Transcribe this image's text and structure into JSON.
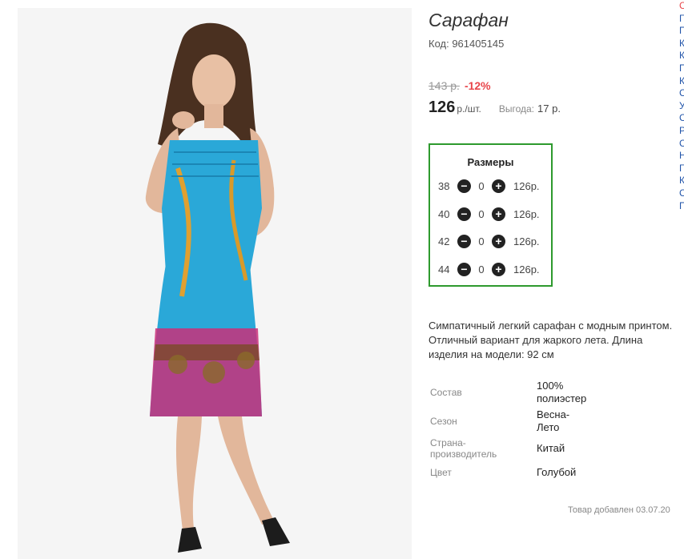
{
  "product": {
    "title": "Сарафан",
    "code": "Код: 961405145",
    "old_price": "143 р.",
    "discount": "-12%",
    "price": "126",
    "price_unit": "р./шт.",
    "benefit_label": "Выгода:",
    "benefit_value": "17 р."
  },
  "sizes": {
    "title": "Размеры",
    "rows": [
      {
        "size": "38",
        "qty": "0",
        "price": "126р."
      },
      {
        "size": "40",
        "qty": "0",
        "price": "126р."
      },
      {
        "size": "42",
        "qty": "0",
        "price": "126р."
      },
      {
        "size": "44",
        "qty": "0",
        "price": "126р."
      }
    ],
    "minus_icon": "minus-circle-icon",
    "plus_icon": "plus-circle-icon"
  },
  "description": "Симпатичный легкий сарафан с модным принтом. Отличный вариант для жаркого лета. Длина изделия на модели: 92 см",
  "properties": [
    {
      "label": "Состав",
      "value": "100% полиэстер"
    },
    {
      "label": "Сезон",
      "value": "Весна-Лето"
    },
    {
      "label": "Страна-производитель",
      "value": "Китай"
    },
    {
      "label": "Цвет",
      "value": "Голубой"
    }
  ],
  "added_text": "Товар добавлен 03.07.20",
  "side_letters": [
    "С",
    "Г",
    "П",
    "К",
    "К",
    "П",
    "К",
    "С",
    "У",
    "С",
    "Р",
    "С",
    "Н",
    "Г",
    "К",
    "С",
    "П"
  ],
  "colors": {
    "accent_red": "#e8454a",
    "sizes_border": "#2e9a2e",
    "dress_blue": "#2aa8d8"
  }
}
